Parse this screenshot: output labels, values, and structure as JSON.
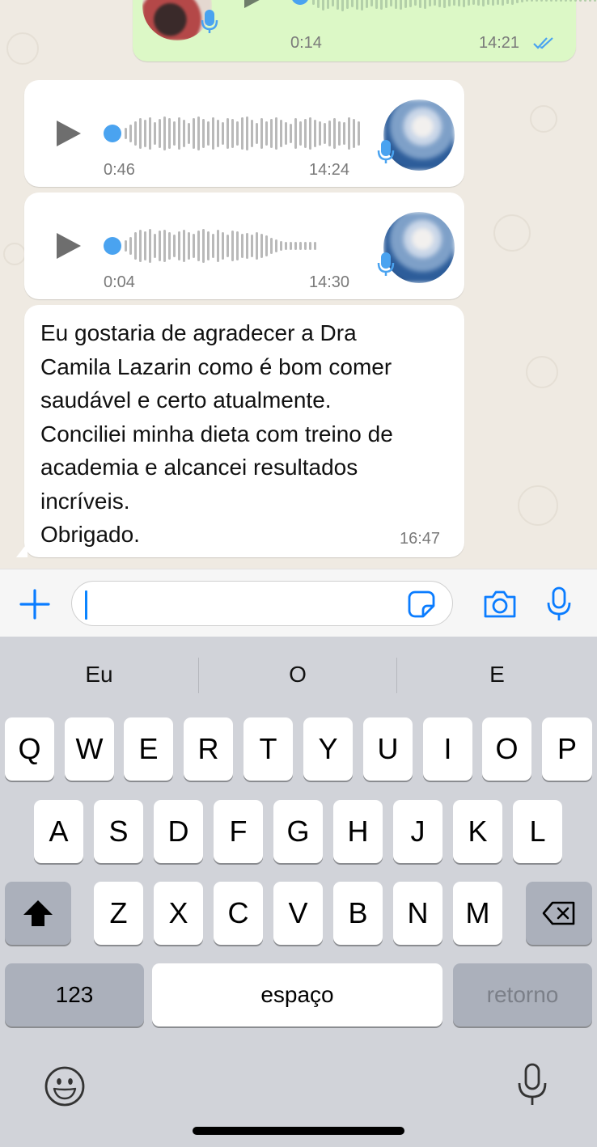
{
  "chat": {
    "outgoing_audio": {
      "duration": "0:14",
      "time": "14:21",
      "status": "read"
    },
    "audio_messages": [
      {
        "duration": "0:46",
        "time": "14:24"
      },
      {
        "duration": "0:04",
        "time": "14:30"
      }
    ],
    "text_message": {
      "lines": [
        "Eu gostaria de agradecer a Dra",
        "Camila Lazarin como é bom comer",
        "saudável e certo atualmente.",
        "Conciliei minha dieta com treino de",
        "academia e alcancei resultados",
        "incríveis.",
        "Obrigado."
      ],
      "time": "16:47"
    }
  },
  "input_bar": {
    "icons": {
      "add": "plus-icon",
      "sticker": "sticker-icon",
      "camera": "camera-icon",
      "mic": "microphone-icon"
    },
    "accent_color": "#0a7cff"
  },
  "keyboard": {
    "suggestions": [
      "Eu",
      "O",
      "E"
    ],
    "rows": [
      [
        "Q",
        "W",
        "E",
        "R",
        "T",
        "Y",
        "U",
        "I",
        "O",
        "P"
      ],
      [
        "A",
        "S",
        "D",
        "F",
        "G",
        "H",
        "J",
        "K",
        "L"
      ],
      [
        "Z",
        "X",
        "C",
        "V",
        "B",
        "N",
        "M"
      ]
    ],
    "numbers_label": "123",
    "space_label": "espaço",
    "return_label": "retorno",
    "icons": {
      "shift": "shift-icon",
      "delete": "backspace-icon",
      "emoji": "emoji-icon",
      "dictation": "dictation-mic-icon"
    }
  }
}
